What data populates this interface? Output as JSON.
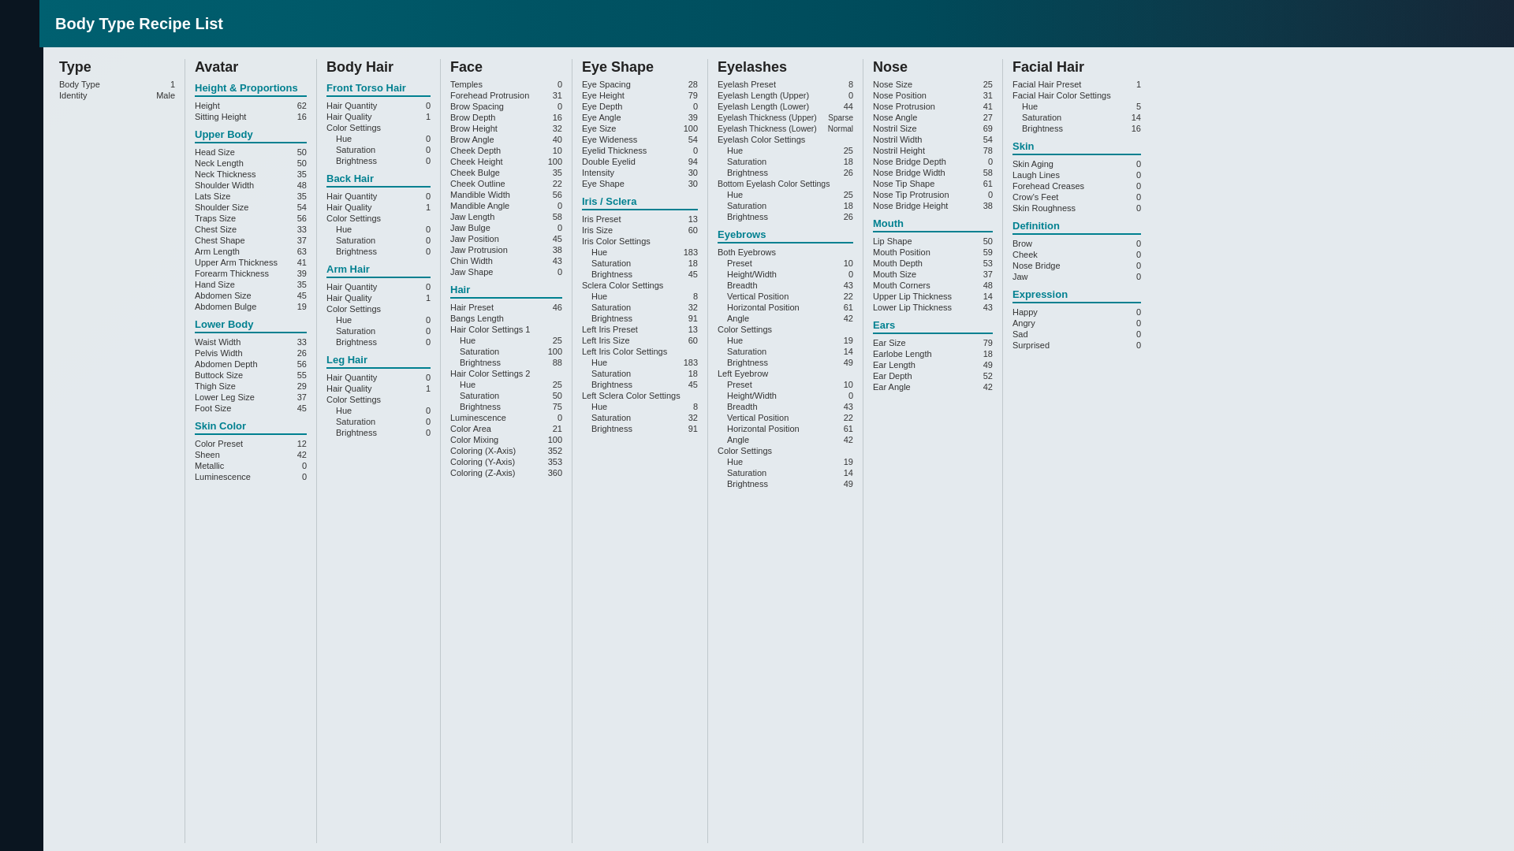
{
  "title": "Body Type Recipe List",
  "type_section": {
    "header": "Type",
    "rows": [
      {
        "label": "Body Type",
        "value": "1"
      },
      {
        "label": "Identity",
        "value": "Male"
      }
    ]
  },
  "avatar_section": {
    "header": "Avatar",
    "subsections": [
      {
        "header": "Height & Proportions",
        "rows": [
          {
            "label": "Height",
            "value": "62"
          },
          {
            "label": "Sitting Height",
            "value": "16"
          }
        ]
      },
      {
        "header": "Upper Body",
        "rows": [
          {
            "label": "Head Size",
            "value": "50"
          },
          {
            "label": "Neck Length",
            "value": "50"
          },
          {
            "label": "Neck Thickness",
            "value": "35"
          },
          {
            "label": "Shoulder Width",
            "value": "48"
          },
          {
            "label": "Lats Size",
            "value": "35"
          },
          {
            "label": "Shoulder Size",
            "value": "54"
          },
          {
            "label": "Traps Size",
            "value": "56"
          },
          {
            "label": "Chest Size",
            "value": "33"
          },
          {
            "label": "Chest Shape",
            "value": "37"
          },
          {
            "label": "Arm Length",
            "value": "63"
          },
          {
            "label": "Upper Arm Thickness",
            "value": "41"
          },
          {
            "label": "Forearm Thickness",
            "value": "39"
          },
          {
            "label": "Hand Size",
            "value": "35"
          },
          {
            "label": "Abdomen Size",
            "value": "45"
          },
          {
            "label": "Abdomen Bulge",
            "value": "19"
          }
        ]
      },
      {
        "header": "Lower Body",
        "rows": [
          {
            "label": "Waist Width",
            "value": "33"
          },
          {
            "label": "Pelvis Width",
            "value": "26"
          },
          {
            "label": "Abdomen Depth",
            "value": "56"
          },
          {
            "label": "Buttock Size",
            "value": "55"
          },
          {
            "label": "Thigh Size",
            "value": "29"
          },
          {
            "label": "Lower Leg Size",
            "value": "37"
          },
          {
            "label": "Foot Size",
            "value": "45"
          }
        ]
      },
      {
        "header": "Skin Color",
        "rows": [
          {
            "label": "Color Preset",
            "value": "12"
          },
          {
            "label": "Sheen",
            "value": "42"
          },
          {
            "label": "Metallic",
            "value": "0"
          },
          {
            "label": "Luminescence",
            "value": "0"
          }
        ]
      }
    ]
  },
  "body_hair_section": {
    "header": "Body Hair",
    "subsections": [
      {
        "header": "Front Torso Hair",
        "rows": [
          {
            "label": "Hair Quantity",
            "value": "0"
          },
          {
            "label": "Hair Quality",
            "value": "1"
          },
          {
            "label": "Color Settings",
            "value": ""
          },
          {
            "label": "Hue",
            "value": "0",
            "indent": true
          },
          {
            "label": "Saturation",
            "value": "0",
            "indent": true
          },
          {
            "label": "Brightness",
            "value": "0",
            "indent": true
          }
        ]
      },
      {
        "header": "Back Hair",
        "rows": [
          {
            "label": "Hair Quantity",
            "value": "0"
          },
          {
            "label": "Hair Quality",
            "value": "1"
          },
          {
            "label": "Color Settings",
            "value": ""
          },
          {
            "label": "Hue",
            "value": "0",
            "indent": true
          },
          {
            "label": "Saturation",
            "value": "0",
            "indent": true
          },
          {
            "label": "Brightness",
            "value": "0",
            "indent": true
          }
        ]
      },
      {
        "header": "Arm Hair",
        "rows": [
          {
            "label": "Hair Quantity",
            "value": "0"
          },
          {
            "label": "Hair Quality",
            "value": "1"
          },
          {
            "label": "Color Settings",
            "value": ""
          },
          {
            "label": "Hue",
            "value": "0",
            "indent": true
          },
          {
            "label": "Saturation",
            "value": "0",
            "indent": true
          },
          {
            "label": "Brightness",
            "value": "0",
            "indent": true
          }
        ]
      },
      {
        "header": "Leg Hair",
        "rows": [
          {
            "label": "Hair Quantity",
            "value": "0"
          },
          {
            "label": "Hair Quality",
            "value": "1"
          },
          {
            "label": "Color Settings",
            "value": ""
          },
          {
            "label": "Hue",
            "value": "0",
            "indent": true
          },
          {
            "label": "Saturation",
            "value": "0",
            "indent": true
          },
          {
            "label": "Brightness",
            "value": "0",
            "indent": true
          }
        ]
      }
    ]
  },
  "face_section": {
    "header": "Face",
    "rows": [
      {
        "label": "Temples",
        "value": "0"
      },
      {
        "label": "Forehead Protrusion",
        "value": "31"
      },
      {
        "label": "Brow Spacing",
        "value": "0"
      },
      {
        "label": "Brow Depth",
        "value": "16"
      },
      {
        "label": "Brow Height",
        "value": "32"
      },
      {
        "label": "Brow Angle",
        "value": "40"
      },
      {
        "label": "Cheek Depth",
        "value": "10"
      },
      {
        "label": "Cheek Height",
        "value": "100"
      },
      {
        "label": "Cheek Bulge",
        "value": "35"
      },
      {
        "label": "Cheek Outline",
        "value": "22"
      },
      {
        "label": "Mandible Width",
        "value": "56"
      },
      {
        "label": "Mandible Angle",
        "value": "0"
      },
      {
        "label": "Jaw Length",
        "value": "58"
      },
      {
        "label": "Jaw Bulge",
        "value": "0"
      },
      {
        "label": "Jaw Position",
        "value": "45"
      },
      {
        "label": "Jaw Protrusion",
        "value": "38"
      },
      {
        "label": "Chin Width",
        "value": "43"
      },
      {
        "label": "Jaw Shape",
        "value": "0"
      }
    ]
  },
  "hair_section": {
    "header": "Hair",
    "rows": [
      {
        "label": "Hair Preset",
        "value": "46"
      },
      {
        "label": "Bangs Length",
        "value": ""
      },
      {
        "label": "Hair Color Settings 1",
        "value": ""
      },
      {
        "label": "Hue",
        "value": "25",
        "indent": true
      },
      {
        "label": "Saturation",
        "value": "100",
        "indent": true
      },
      {
        "label": "Brightness",
        "value": "88",
        "indent": true
      },
      {
        "label": "Hair Color Settings 2",
        "value": ""
      },
      {
        "label": "Hue",
        "value": "25",
        "indent": true
      },
      {
        "label": "Saturation",
        "value": "50",
        "indent": true
      },
      {
        "label": "Brightness",
        "value": "75",
        "indent": true
      },
      {
        "label": "Luminescence",
        "value": "0"
      },
      {
        "label": "Color Area",
        "value": "21"
      },
      {
        "label": "Color Mixing",
        "value": "100"
      },
      {
        "label": "Coloring (X-Axis)",
        "value": "352"
      },
      {
        "label": "Coloring (Y-Axis)",
        "value": "353"
      },
      {
        "label": "Coloring (Z-Axis)",
        "value": "360"
      }
    ]
  },
  "eye_shape_section": {
    "header": "Eye Shape",
    "rows": [
      {
        "label": "Eye Spacing",
        "value": "28"
      },
      {
        "label": "Eye Height",
        "value": "79"
      },
      {
        "label": "Eye Depth",
        "value": "0"
      },
      {
        "label": "Eye Angle",
        "value": "39"
      },
      {
        "label": "Eye Size",
        "value": "100"
      },
      {
        "label": "Eye Wideness",
        "value": "54"
      },
      {
        "label": "Eyelid Thickness",
        "value": "0"
      },
      {
        "label": "Double Eyelid",
        "value": "94"
      },
      {
        "label": "Intensity",
        "value": "30"
      },
      {
        "label": "Eye Shape",
        "value": "30"
      }
    ]
  },
  "iris_sclera_section": {
    "header": "Iris / Sclera",
    "rows": [
      {
        "label": "Iris Preset",
        "value": "13"
      },
      {
        "label": "Iris Size",
        "value": "60"
      },
      {
        "label": "Iris Color Settings",
        "value": ""
      },
      {
        "label": "Hue",
        "value": "183",
        "indent": true
      },
      {
        "label": "Saturation",
        "value": "18",
        "indent": true
      },
      {
        "label": "Brightness",
        "value": "45",
        "indent": true
      },
      {
        "label": "Sclera Color Settings",
        "value": ""
      },
      {
        "label": "Hue",
        "value": "8",
        "indent": true
      },
      {
        "label": "Saturation",
        "value": "32",
        "indent": true
      },
      {
        "label": "Brightness",
        "value": "91",
        "indent": true
      },
      {
        "label": "Left Iris Preset",
        "value": "13"
      },
      {
        "label": "Left Iris Size",
        "value": "60"
      },
      {
        "label": "Left Iris Color Settings",
        "value": ""
      },
      {
        "label": "Hue",
        "value": "183",
        "indent": true
      },
      {
        "label": "Saturation",
        "value": "18",
        "indent": true
      },
      {
        "label": "Brightness",
        "value": "45",
        "indent": true
      },
      {
        "label": "Left Sclera Color Settings",
        "value": ""
      },
      {
        "label": "Hue",
        "value": "8",
        "indent": true
      },
      {
        "label": "Saturation",
        "value": "32",
        "indent": true
      },
      {
        "label": "Brightness",
        "value": "91",
        "indent": true
      }
    ]
  },
  "eyelashes_section": {
    "header": "Eyelashes",
    "rows": [
      {
        "label": "Eyelash Preset",
        "value": "8"
      },
      {
        "label": "Eyelash Length (Upper)",
        "value": "0"
      },
      {
        "label": "Eyelash Length (Lower)",
        "value": "44"
      },
      {
        "label": "Eyelash Thickness (Upper)",
        "value": "Sparse"
      },
      {
        "label": "Eyelash Thickness (Lower)",
        "value": "Normal"
      },
      {
        "label": "Eyelash Color Settings",
        "value": ""
      },
      {
        "label": "Hue",
        "value": "25",
        "indent": true
      },
      {
        "label": "Saturation",
        "value": "18",
        "indent": true
      },
      {
        "label": "Brightness",
        "value": "26",
        "indent": true
      },
      {
        "label": "Bottom Eyelash Color Settings",
        "value": ""
      },
      {
        "label": "Hue",
        "value": "25",
        "indent": true
      },
      {
        "label": "Saturation",
        "value": "18",
        "indent": true
      },
      {
        "label": "Brightness",
        "value": "26",
        "indent": true
      }
    ]
  },
  "eyebrows_section": {
    "header": "Eyebrows",
    "rows": [
      {
        "label": "Both Eyebrows",
        "value": ""
      },
      {
        "label": "Preset",
        "value": "10",
        "indent": true
      },
      {
        "label": "Height/Width",
        "value": "0",
        "indent": true
      },
      {
        "label": "Breadth",
        "value": "43",
        "indent": true
      },
      {
        "label": "Vertical Position",
        "value": "22",
        "indent": true
      },
      {
        "label": "Horizontal Position",
        "value": "61",
        "indent": true
      },
      {
        "label": "Angle",
        "value": "42",
        "indent": true
      },
      {
        "label": "Color Settings",
        "value": ""
      },
      {
        "label": "Hue",
        "value": "19",
        "indent": true
      },
      {
        "label": "Saturation",
        "value": "14",
        "indent": true
      },
      {
        "label": "Brightness",
        "value": "49",
        "indent": true
      },
      {
        "label": "Left Eyebrow",
        "value": ""
      },
      {
        "label": "Preset",
        "value": "10",
        "indent": true
      },
      {
        "label": "Height/Width",
        "value": "0",
        "indent": true
      },
      {
        "label": "Breadth",
        "value": "43",
        "indent": true
      },
      {
        "label": "Vertical Position",
        "value": "22",
        "indent": true
      },
      {
        "label": "Horizontal Position",
        "value": "61",
        "indent": true
      },
      {
        "label": "Angle",
        "value": "42",
        "indent": true
      },
      {
        "label": "Color Settings",
        "value": ""
      },
      {
        "label": "Hue",
        "value": "19",
        "indent": true
      },
      {
        "label": "Saturation",
        "value": "14",
        "indent": true
      },
      {
        "label": "Brightness",
        "value": "49",
        "indent": true
      }
    ]
  },
  "nose_section": {
    "header": "Nose",
    "rows": [
      {
        "label": "Nose Size",
        "value": "25"
      },
      {
        "label": "Nose Position",
        "value": "31"
      },
      {
        "label": "Nose Protrusion",
        "value": "41"
      },
      {
        "label": "Nose Angle",
        "value": "27"
      },
      {
        "label": "Nostril Size",
        "value": "69"
      },
      {
        "label": "Nostril Width",
        "value": "54"
      },
      {
        "label": "Nostril Height",
        "value": "78"
      },
      {
        "label": "Nose Bridge Depth",
        "value": "0"
      },
      {
        "label": "Nose Bridge Width",
        "value": "58"
      },
      {
        "label": "Nose Tip Shape",
        "value": "61"
      },
      {
        "label": "Nose Tip Protrusion",
        "value": "0"
      },
      {
        "label": "Nose Bridge Height",
        "value": "38"
      }
    ]
  },
  "mouth_section": {
    "header": "Mouth",
    "rows": [
      {
        "label": "Lip Shape",
        "value": "50"
      },
      {
        "label": "Mouth Position",
        "value": "59"
      },
      {
        "label": "Mouth Depth",
        "value": "53"
      },
      {
        "label": "Mouth Size",
        "value": "37"
      },
      {
        "label": "Mouth Corners",
        "value": "48"
      },
      {
        "label": "Upper Lip Thickness",
        "value": "14"
      },
      {
        "label": "Lower Lip Thickness",
        "value": "43"
      }
    ]
  },
  "ears_section": {
    "header": "Ears",
    "rows": [
      {
        "label": "Ear Size",
        "value": "79"
      },
      {
        "label": "Earlobe Length",
        "value": "18"
      },
      {
        "label": "Ear Length",
        "value": "49"
      },
      {
        "label": "Ear Depth",
        "value": "52"
      },
      {
        "label": "Ear Angle",
        "value": "42"
      }
    ]
  },
  "facial_hair_section": {
    "header": "Facial Hair",
    "rows": [
      {
        "label": "Facial Hair Preset",
        "value": "1"
      },
      {
        "label": "Facial Hair Color Settings",
        "value": ""
      },
      {
        "label": "Hue",
        "value": "5",
        "indent": true
      },
      {
        "label": "Saturation",
        "value": "14",
        "indent": true
      },
      {
        "label": "Brightness",
        "value": "16",
        "indent": true
      }
    ]
  },
  "skin_section": {
    "header": "Skin",
    "rows": [
      {
        "label": "Skin Aging",
        "value": "0"
      },
      {
        "label": "Laugh Lines",
        "value": "0"
      },
      {
        "label": "Forehead Creases",
        "value": "0"
      },
      {
        "label": "Crow's Feet",
        "value": "0"
      },
      {
        "label": "Skin Roughness",
        "value": "0"
      }
    ]
  },
  "definition_section": {
    "header": "Definition",
    "rows": [
      {
        "label": "Brow",
        "value": "0"
      },
      {
        "label": "Cheek",
        "value": "0"
      },
      {
        "label": "Nose Bridge",
        "value": "0"
      },
      {
        "label": "Jaw",
        "value": "0"
      }
    ]
  },
  "expression_section": {
    "header": "Expression",
    "rows": [
      {
        "label": "Happy",
        "value": "0"
      },
      {
        "label": "Angry",
        "value": "0"
      },
      {
        "label": "Sad",
        "value": "0"
      },
      {
        "label": "Surprised",
        "value": "0"
      }
    ]
  }
}
